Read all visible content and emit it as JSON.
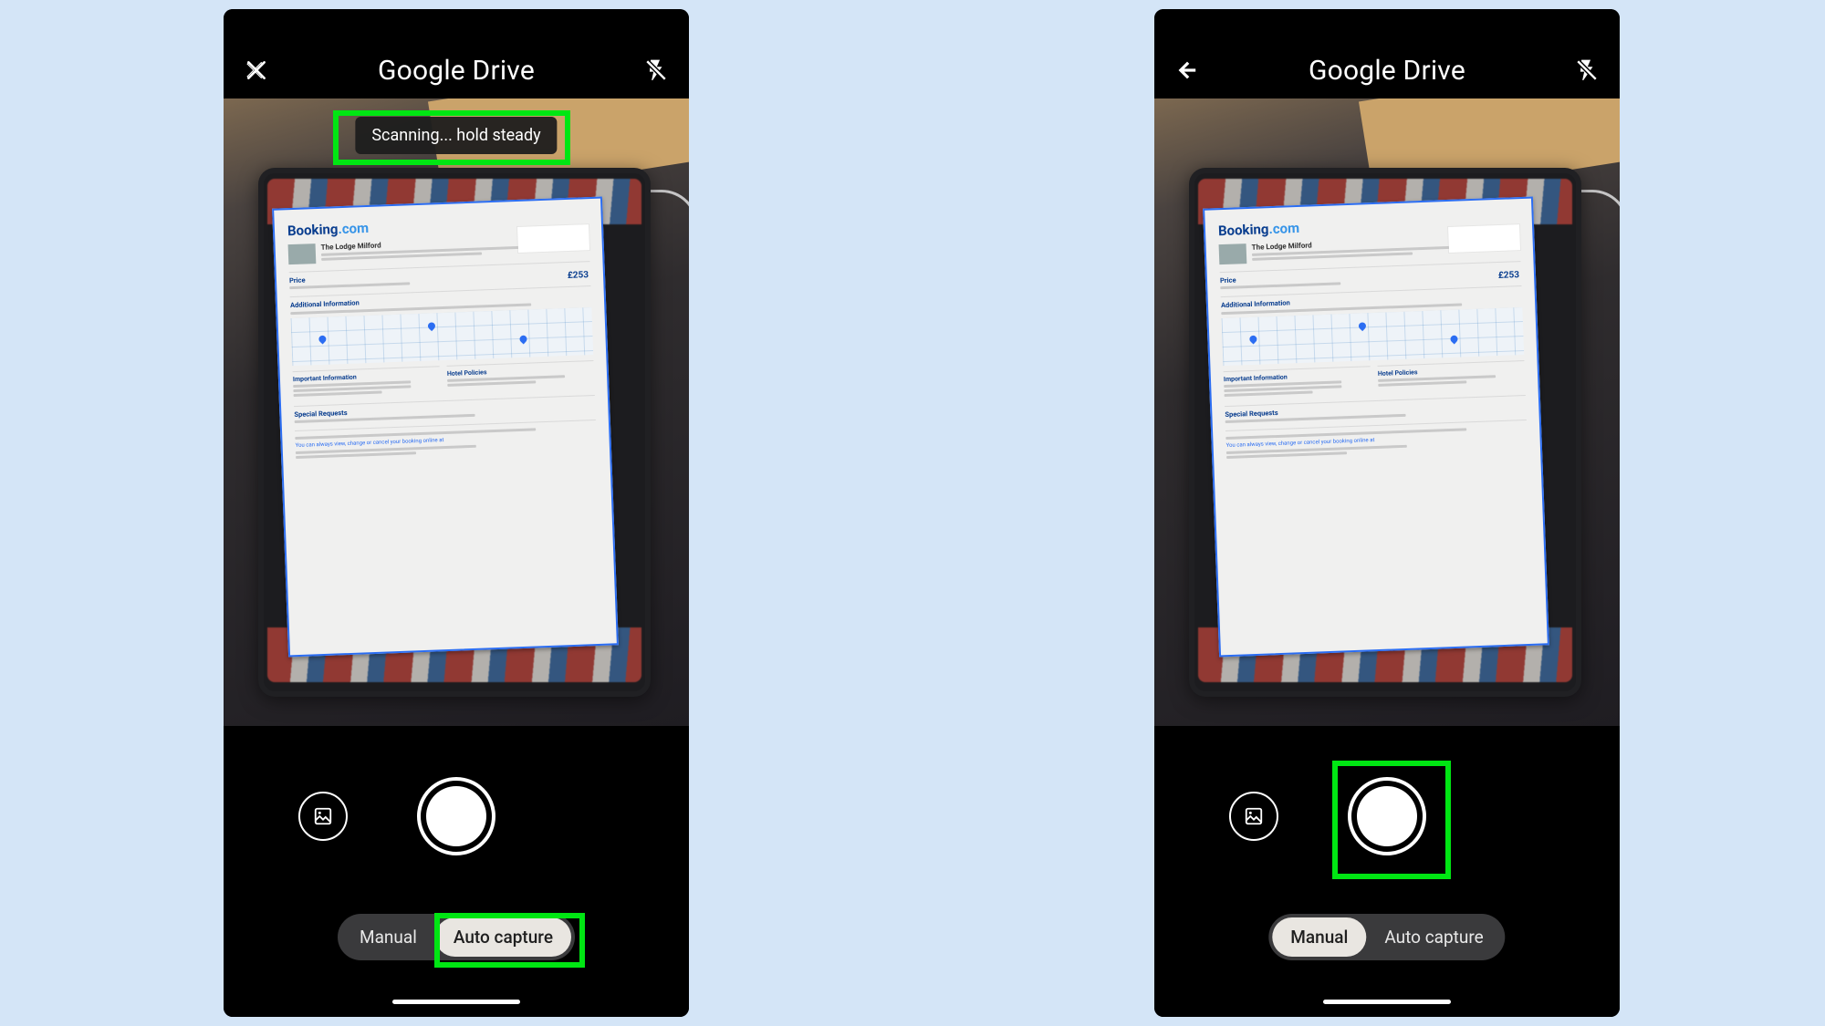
{
  "colors": {
    "page_bg": "#d4e5f7",
    "callout": "#00e613",
    "doc_border": "#2b6df2"
  },
  "left": {
    "title": "Google Drive",
    "left_icon": "close-icon",
    "right_icon": "flash-off-icon",
    "toast": "Scanning... hold steady",
    "modes": {
      "manual": "Manual",
      "auto": "Auto capture",
      "active": "auto"
    },
    "callouts": [
      "toast",
      "auto-capture-pill"
    ],
    "document": {
      "brand_main": "Booking",
      "brand_suffix": ".com",
      "hotel_name": "The Lodge Milford",
      "section_price": "Price",
      "price_value": "£253",
      "section_additional": "Additional Information",
      "section_hotel_policies": "Hotel Policies",
      "section_important": "Important Information",
      "section_special": "Special Requests",
      "footer_note": "You can always view, change or cancel your booking online at"
    }
  },
  "right": {
    "title": "Google Drive",
    "left_icon": "back-icon",
    "right_icon": "flash-off-icon",
    "modes": {
      "manual": "Manual",
      "auto": "Auto capture",
      "active": "manual"
    },
    "callouts": [
      "shutter-button"
    ],
    "document": {
      "brand_main": "Booking",
      "brand_suffix": ".com",
      "hotel_name": "The Lodge Milford",
      "section_price": "Price",
      "price_value": "£253",
      "section_additional": "Additional Information",
      "section_hotel_policies": "Hotel Policies",
      "section_important": "Important Information",
      "section_special": "Special Requests",
      "footer_note": "You can always view, change or cancel your booking online at"
    }
  }
}
